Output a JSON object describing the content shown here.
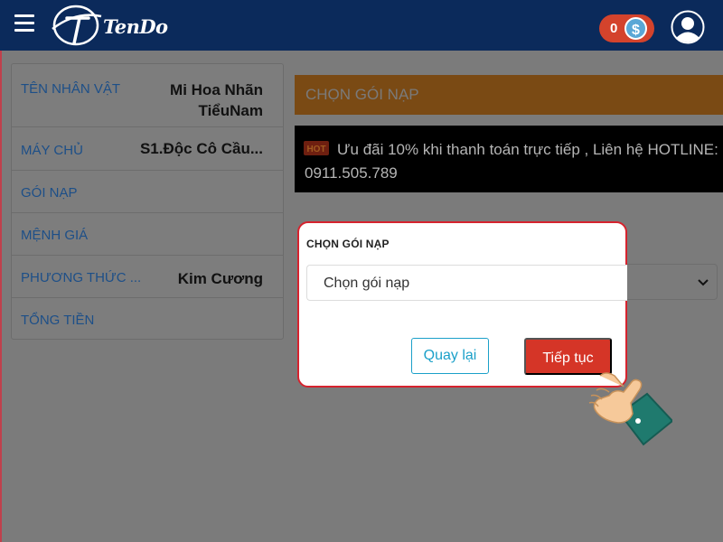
{
  "header": {
    "logo_text": "TenDo",
    "coin_count": "0",
    "coin_symbol": "$",
    "icons": [
      "hamburger-menu-icon",
      "tendo-logo",
      "coin-icon",
      "user-avatar-icon"
    ]
  },
  "info_panel": {
    "rows": [
      {
        "label": "TÊN NHÂN VẬT",
        "value_line1": "Mi Hoa Nhãn",
        "value_line2": "TiểuNam"
      },
      {
        "label": "MÁY CHỦ",
        "value": "S1.Độc Cô Cầu..."
      },
      {
        "label": "GÓI NẠP",
        "value": ""
      },
      {
        "label": "MỆNH GIÁ",
        "value": ""
      },
      {
        "label": "PHƯƠNG THỨC ...",
        "value": "Kim Cương"
      },
      {
        "label": "TỔNG TIỀN",
        "value": ""
      }
    ]
  },
  "main": {
    "section_title": "CHỌN GÓI NẠP",
    "promo_badge": "HOT",
    "promo_text": "Ưu đãi 10% khi thanh toán trực tiếp , Liên hệ HOTLINE: 0911.505.789"
  },
  "modal": {
    "label": "CHỌN GÓI NẠP",
    "select_value": "Chọn gói nạp",
    "back_label": "Quay lại",
    "next_label": "Tiếp tục"
  },
  "colors": {
    "header_bg": "#0b2a5b",
    "accent_orange": "#e07b1b",
    "primary_red": "#d53527",
    "link_blue": "#1ba0c9",
    "modal_border": "#d6232e"
  }
}
